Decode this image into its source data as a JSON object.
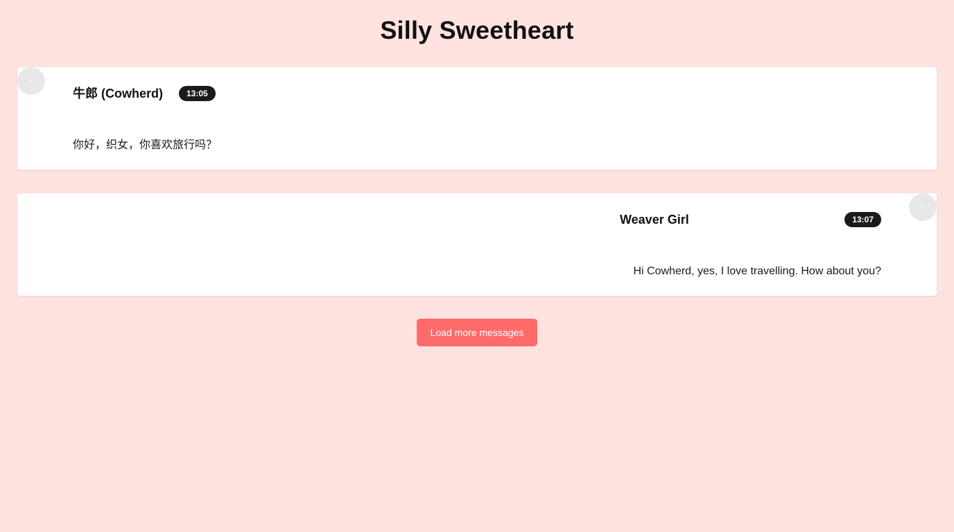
{
  "page": {
    "title": "Silly Sweetheart",
    "background_color": "#ffe3e0"
  },
  "messages": [
    {
      "sender": "牛郎 (Cowherd)",
      "time": "13:05",
      "text": "你好，织女，你喜欢旅行吗？",
      "avatar_icon": "avatar-placeholder",
      "alignment": "left"
    },
    {
      "sender": "Weaver Girl",
      "time": "13:07",
      "text": "Hi Cowherd, yes, I love travelling. How about you?",
      "avatar_icon": "avatar-placeholder",
      "alignment": "right"
    }
  ],
  "load_more": {
    "label": "Load more messages",
    "color": "#ff6b6b"
  },
  "colors": {
    "card": "#ffffff",
    "badge": "#1a1a1a"
  }
}
